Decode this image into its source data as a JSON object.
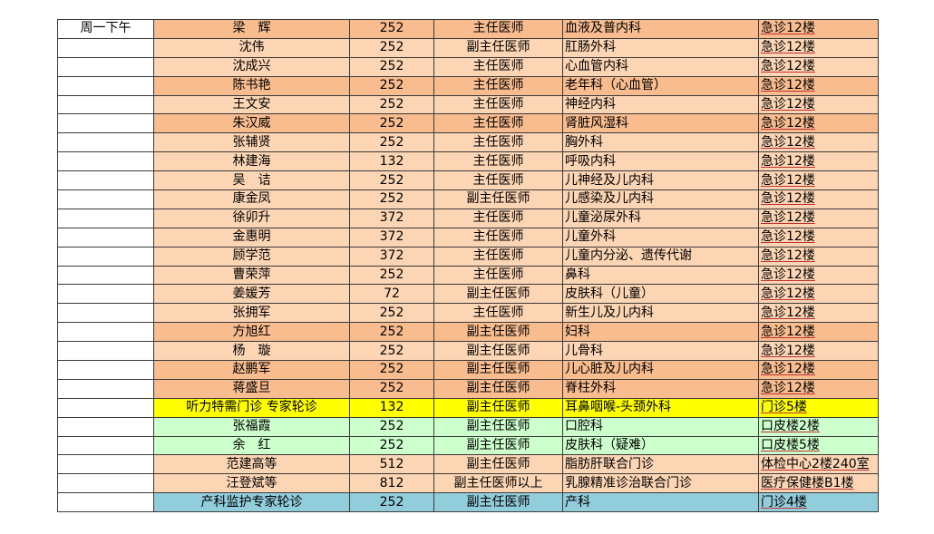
{
  "session_label": "周一下午",
  "colors": {
    "orange_light": "#fcd5b4",
    "orange_dark": "#f8bc8f",
    "yellow": "#ffff00",
    "green": "#ccffcc",
    "blue": "#92cddc"
  },
  "rows": [
    {
      "name": "梁　辉",
      "code": "252",
      "title": "主任医师",
      "dept": "血液及普内科",
      "loc": "急诊12楼",
      "bg": "orange_dark"
    },
    {
      "name": "沈伟",
      "code": "252",
      "title": "副主任医师",
      "dept": "肛肠外科",
      "loc": "急诊12楼",
      "bg": "orange_light"
    },
    {
      "name": "沈成兴",
      "code": "252",
      "title": "主任医师",
      "dept": "心血管内科",
      "loc": "急诊12楼",
      "bg": "orange_light"
    },
    {
      "name": "陈书艳",
      "code": "252",
      "title": "主任医师",
      "dept": "老年科（心血管）",
      "loc": "急诊12楼",
      "bg": "orange_dark"
    },
    {
      "name": "王文安",
      "code": "252",
      "title": "主任医师",
      "dept": "神经内科",
      "loc": "急诊12楼",
      "bg": "orange_light"
    },
    {
      "name": "朱汉威",
      "code": "252",
      "title": "主任医师",
      "dept": "肾脏风湿科",
      "loc": "急诊12楼",
      "bg": "orange_dark"
    },
    {
      "name": "张辅贤",
      "code": "252",
      "title": "主任医师",
      "dept": "胸外科",
      "loc": "急诊12楼",
      "bg": "orange_light"
    },
    {
      "name": "林建海",
      "code": "132",
      "title": "主任医师",
      "dept": "呼吸内科",
      "loc": "急诊12楼",
      "bg": "orange_light"
    },
    {
      "name": "吴　诘",
      "code": "252",
      "title": "主任医师",
      "dept": "儿神经及儿内科",
      "loc": "急诊12楼",
      "bg": "orange_light"
    },
    {
      "name": "康金凤",
      "code": "252",
      "title": "副主任医师",
      "dept": "儿感染及儿内科",
      "loc": "急诊12楼",
      "bg": "orange_light"
    },
    {
      "name": "徐卯升",
      "code": "372",
      "title": "主任医师",
      "dept": "儿童泌尿外科",
      "loc": "急诊12楼",
      "bg": "orange_light"
    },
    {
      "name": "金惠明",
      "code": "372",
      "title": "主任医师",
      "dept": "儿童外科",
      "loc": "急诊12楼",
      "bg": "orange_light"
    },
    {
      "name": "顾学范",
      "code": "372",
      "title": "主任医师",
      "dept": "儿童内分泌、遗传代谢",
      "loc": "急诊12楼",
      "bg": "orange_light"
    },
    {
      "name": "曹荣萍",
      "code": "252",
      "title": "主任医师",
      "dept": "鼻科",
      "loc": "急诊12楼",
      "bg": "orange_light"
    },
    {
      "name": "姜媛芳",
      "code": "72",
      "title": "副主任医师",
      "dept": "皮肤科（儿童）",
      "loc": "急诊12楼",
      "bg": "orange_light"
    },
    {
      "name": "张拥军",
      "code": "252",
      "title": "主任医师",
      "dept": "新生儿及儿内科",
      "loc": "急诊12楼",
      "bg": "orange_light"
    },
    {
      "name": "方旭红",
      "code": "252",
      "title": "副主任医师",
      "dept": "妇科",
      "loc": "急诊12楼",
      "bg": "orange_dark"
    },
    {
      "name": "杨　璇",
      "code": "252",
      "title": "副主任医师",
      "dept": "儿骨科",
      "loc": "急诊12楼",
      "bg": "orange_light"
    },
    {
      "name": "赵鹏军",
      "code": "252",
      "title": "副主任医师",
      "dept": "儿心脏及儿内科",
      "loc": "急诊12楼",
      "bg": "orange_dark"
    },
    {
      "name": "蒋盛旦",
      "code": "252",
      "title": "副主任医师",
      "dept": "脊柱外科",
      "loc": "急诊12楼",
      "bg": "orange_dark"
    },
    {
      "name": "听力特需门诊 专家轮诊",
      "code": "132",
      "title": "副主任医师",
      "dept": "耳鼻咽喉-头颈外科",
      "loc": "门诊5楼",
      "bg": "yellow"
    },
    {
      "name": "张福霞",
      "code": "252",
      "title": "副主任医师",
      "dept": "口腔科",
      "loc": "口皮楼2楼",
      "bg": "green"
    },
    {
      "name": "余　红",
      "code": "252",
      "title": "副主任医师",
      "dept": "皮肤科（疑难）",
      "loc": "口皮楼5楼",
      "bg": "green"
    },
    {
      "name": "范建高等",
      "code": "512",
      "title": "副主任医师",
      "dept": "脂肪肝联合门诊",
      "loc": "体检中心2楼240室",
      "bg": "orange_light"
    },
    {
      "name": "汪登斌等",
      "code": "812",
      "title": "副主任医师以上",
      "dept": "乳腺精准诊治联合门诊",
      "loc": "医疗保健楼B1楼",
      "bg": "orange_light"
    },
    {
      "name": "产科监护专家轮诊",
      "code": "252",
      "title": "副主任医师",
      "dept": "产科",
      "loc": "门诊4楼",
      "bg": "blue"
    }
  ]
}
